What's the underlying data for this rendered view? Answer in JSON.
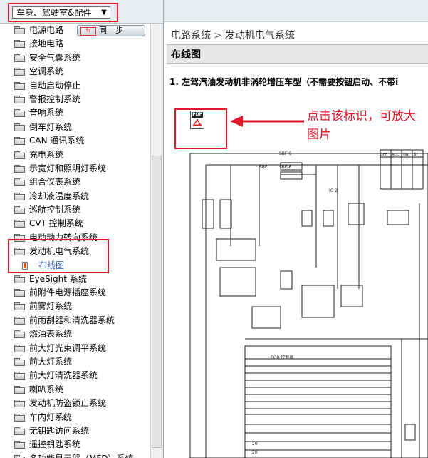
{
  "category_select": {
    "value": "车身、驾驶室&配件"
  },
  "sync_button": {
    "icon": "sync-icon",
    "icon_text": "⇆",
    "label": "同步"
  },
  "tree": {
    "items": [
      "电源电路",
      "接地电路",
      "安全气囊系统",
      "空调系统",
      "自动启动停止",
      "警报控制系统",
      "音响系统",
      "倒车灯系统",
      "CAN 通讯系统",
      "充电系统",
      "示宽灯和照明灯系统",
      "组合仪表系统",
      "冷却液温度系统",
      "巡航控制系统",
      "CVT 控制系统",
      "电动动力转向系统",
      "发动机电气系统"
    ],
    "expanded_child": "布线图",
    "items_after": [
      "EyeSight 系统",
      "前附件电源插座系统",
      "前雾灯系统",
      "前雨刮器和清洗器系统",
      "燃油表系统",
      "前大灯光束调平系统",
      "前大灯系统",
      "前大灯清洗器系统",
      "喇叭系统",
      "发动机防盗锁止系统",
      "车内灯系统",
      "无钥匙访问系统",
      "遥控钥匙系统",
      "多功能显示器（MFD）系统"
    ]
  },
  "breadcrumb": {
    "parent": "电路系统",
    "separator": ">",
    "current": "发动机电气系统"
  },
  "section_header": "布线图",
  "section_title": "1.  左驾汽油发动机非涡轮增压车型（不需要按钮启动、不带i",
  "pdf_icon": {
    "name": "pdf-icon",
    "text": "PDF"
  },
  "annotation": "点击该标识，可放大图片",
  "diagram_labels": {
    "sbf6": "SBF-6",
    "sbf8": "SBF-8",
    "sbf": "SBF",
    "ig2": "IG 2",
    "egr": "EGR 控制阀",
    "label20a": "20",
    "label20b": "20",
    "off": "OFF",
    "acc": "ACC",
    "on": "ON",
    "st": "ST"
  },
  "colors": {
    "accent_red": "#e0162b",
    "link_blue": "#2f5aa8"
  }
}
